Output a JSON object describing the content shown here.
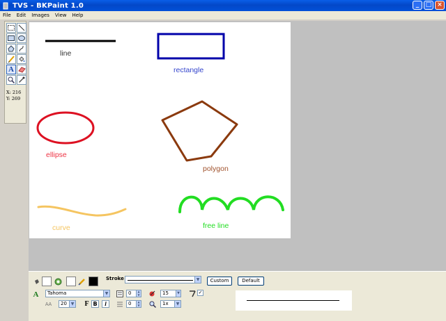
{
  "window": {
    "title": "TVS - BKPaint 1.0"
  },
  "menu": [
    "File",
    "Edit",
    "Images",
    "View",
    "Help"
  ],
  "toolbox": {
    "tools": [
      "select-rect-tool-icon",
      "line-tool-icon",
      "rectangle-tool-icon",
      "ellipse-tool-icon",
      "polygon-tool-icon",
      "curve-tool-icon",
      "pencil-tool-icon",
      "fill-tool-icon",
      "text-tool-icon",
      "eraser-tool-icon",
      "zoom-tool-icon",
      "eyedropper-tool-icon"
    ],
    "selected": "text-tool-icon",
    "coord_x": "X: 216",
    "coord_y": "Y: 269"
  },
  "canvas": {
    "labels": {
      "line": "line",
      "rectangle": "rectangle",
      "ellipse": "ellipse",
      "polygon": "polygon",
      "curve": "curve",
      "free_line": "free line"
    },
    "colors": {
      "line": "#000000",
      "rectangle": "#0000aa",
      "ellipse": "#dd1122",
      "polygon": "#8b3a0e",
      "curve": "#f5c561",
      "free_line": "#22dd22",
      "rectangle_label": "#3344cc",
      "ellipse_label": "#ee3344",
      "polygon_label": "#a0522d"
    }
  },
  "properties": {
    "stroke_label": "Stroke",
    "custom_button": "Custom",
    "default_button": "Default",
    "font_name": "Tahoma",
    "font_size": "20",
    "bold": "B",
    "italic": "I",
    "spin1": "0",
    "spin2": "15",
    "spin3": "0",
    "zoom": "1x"
  }
}
